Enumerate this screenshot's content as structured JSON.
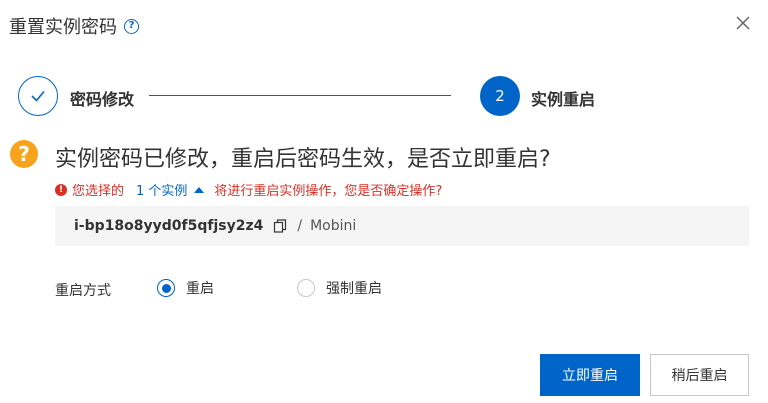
{
  "dialog": {
    "title": "重置实例密码",
    "help_icon": "question-circle-icon",
    "close_icon": "close-icon"
  },
  "steps": [
    {
      "label": "密码修改",
      "status": "done",
      "icon": "check-icon"
    },
    {
      "label": "实例重启",
      "status": "active",
      "number": "2"
    }
  ],
  "confirm": {
    "icon": "warning-question-icon",
    "question": "实例密码已修改，重启后密码生效，是否立即重启?",
    "warning_prefix": "您选择的",
    "instance_link": "1 个实例",
    "warning_suffix": "将进行重启实例操作，您是否确定操作?"
  },
  "instance": {
    "id": "i-bp18o8yyd0f5qfjsy2z4",
    "separator": "/",
    "name": "Mobini"
  },
  "restart": {
    "label": "重启方式",
    "options": [
      {
        "label": "重启",
        "selected": true
      },
      {
        "label": "强制重启",
        "selected": false
      }
    ]
  },
  "footer": {
    "confirm_label": "立即重启",
    "later_label": "稍后重启"
  },
  "colors": {
    "primary": "#0064c8",
    "warning": "#f8a31c",
    "error": "#d93026"
  }
}
